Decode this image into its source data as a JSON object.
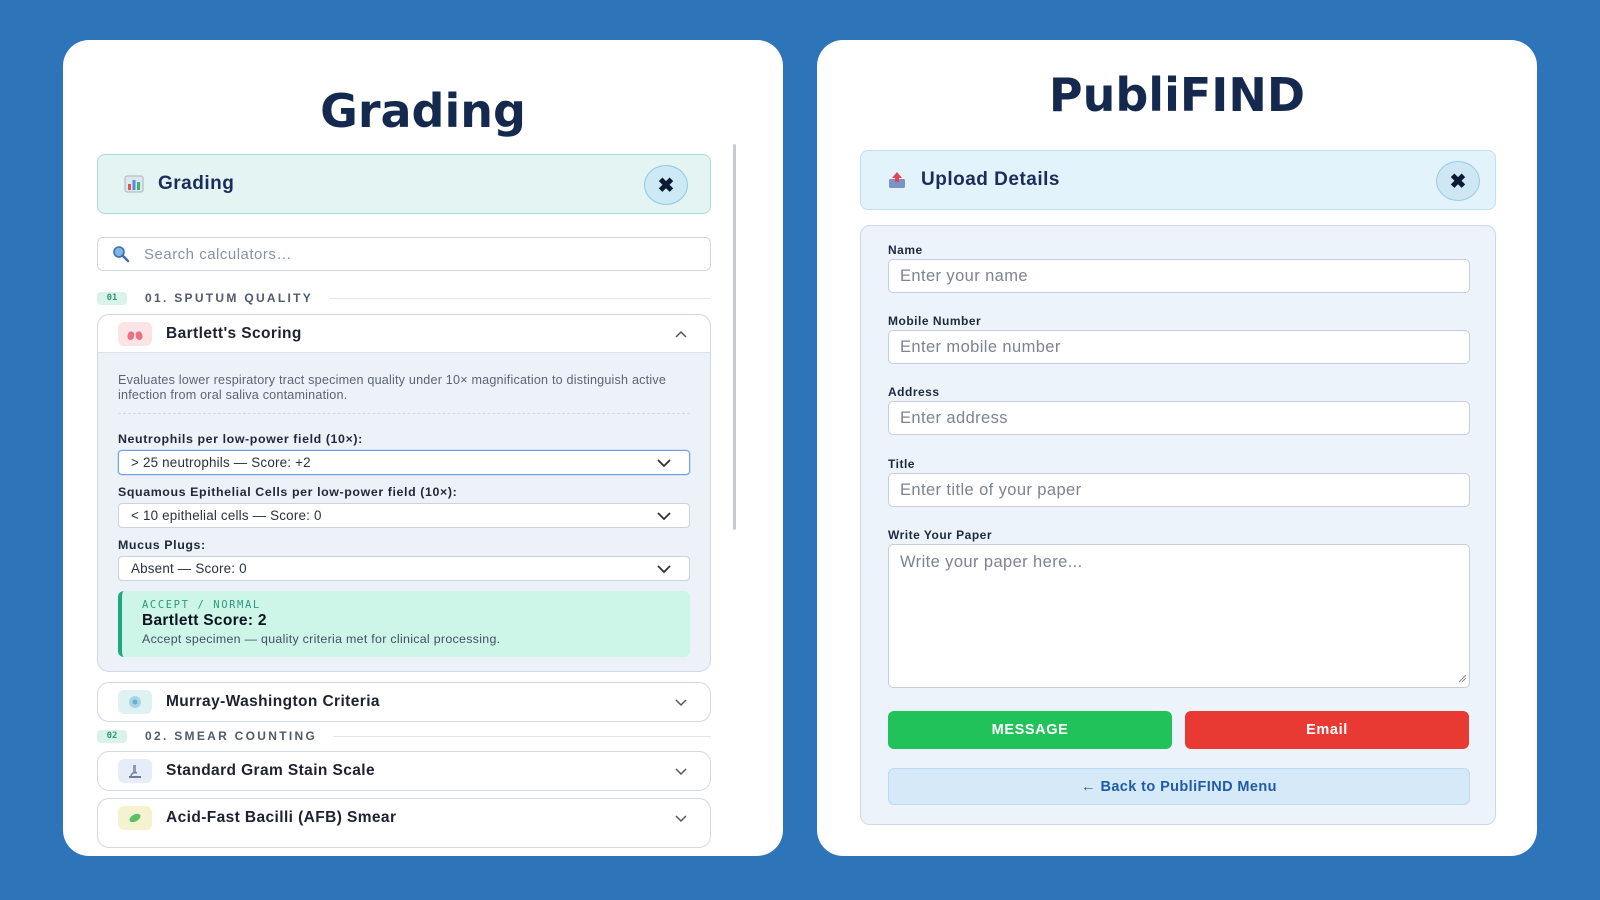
{
  "colors": {
    "background": "#2e74b8",
    "accent_green": "#22c25a",
    "accent_red": "#e83a33",
    "title_navy": "#15294f"
  },
  "left_card": {
    "title": "Grading",
    "panel_header": {
      "icon": "bar-chart-icon",
      "title": "Grading",
      "close_label": "✖"
    },
    "search": {
      "placeholder": "Search calculators…",
      "icon": "search-icon"
    },
    "sections": [
      {
        "badge": "01",
        "label": "01. SPUTUM QUALITY"
      },
      {
        "badge": "02",
        "label": "02. SMEAR COUNTING"
      }
    ],
    "bartlett": {
      "title": "Bartlett's Scoring",
      "icon": "lungs-icon",
      "description": "Evaluates lower respiratory tract specimen quality under 10× magnification to distinguish active infection from oral saliva contamination.",
      "fields": [
        {
          "label": "Neutrophils per low-power field (10×):",
          "value": "> 25 neutrophils — Score: +2"
        },
        {
          "label": "Squamous Epithelial Cells per low-power field (10×):",
          "value": "< 10 epithelial cells — Score: 0"
        },
        {
          "label": "Mucus Plugs:",
          "value": "Absent — Score: 0"
        }
      ],
      "result": {
        "tag": "ACCEPT / NORMAL",
        "score": "Bartlett Score: 2",
        "note": "Accept specimen — quality criteria met for clinical processing."
      }
    },
    "murray": {
      "title": "Murray-Washington Criteria",
      "icon": "cell-icon"
    },
    "gram": {
      "title": "Standard Gram Stain Scale",
      "icon": "microscope-icon"
    },
    "afb": {
      "title": "Acid-Fast Bacilli (AFB) Smear",
      "icon": "bacteria-icon"
    }
  },
  "right_card": {
    "title": "PubliFIND",
    "panel_header": {
      "icon": "upload-icon",
      "title": "Upload Details",
      "close_label": "✖"
    },
    "form": {
      "name": {
        "label": "Name",
        "placeholder": "Enter your name"
      },
      "mobile": {
        "label": "Mobile Number",
        "placeholder": "Enter mobile number"
      },
      "address": {
        "label": "Address",
        "placeholder": "Enter address"
      },
      "title": {
        "label": "Title",
        "placeholder": "Enter title of your paper"
      },
      "paper": {
        "label": "Write Your Paper",
        "placeholder": "Write your paper here..."
      }
    },
    "buttons": {
      "message": "MESSAGE",
      "email": "Email",
      "back": "← Back to PubliFIND Menu"
    }
  }
}
